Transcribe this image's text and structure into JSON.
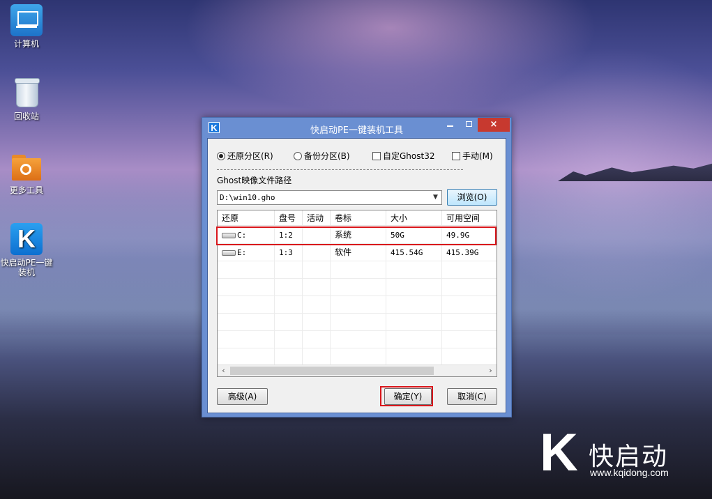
{
  "desktop": {
    "icons": [
      {
        "label": "计算机",
        "icon": "computer-icon"
      },
      {
        "label": "回收站",
        "icon": "recycle-bin-icon"
      },
      {
        "label": "更多工具",
        "icon": "tools-folder-icon"
      },
      {
        "label": "快启动PE一键装机",
        "icon": "kqidong-installer-icon"
      }
    ]
  },
  "dialog": {
    "title": "快启动PE一键装机工具",
    "logo_glyph": "K",
    "close_glyph": "×",
    "options": {
      "restore": {
        "label": "还原分区(R)",
        "checked": true
      },
      "backup": {
        "label": "备份分区(B)",
        "checked": false
      },
      "custom_ghost32": {
        "label": "自定Ghost32",
        "checked": false
      },
      "manual": {
        "label": "手动(M)",
        "checked": false
      }
    },
    "path_label": "Ghost映像文件路径",
    "path_value": "D:\\win10.gho",
    "browse_label": "浏览(O)",
    "table": {
      "columns": [
        "还原",
        "盘号",
        "活动",
        "卷标",
        "大小",
        "可用空间"
      ],
      "rows": [
        {
          "drive": "C:",
          "disk": "1:2",
          "active": "",
          "volume": "系统",
          "size": "50G",
          "free": "49.9G",
          "selected": true
        },
        {
          "drive": "E:",
          "disk": "1:3",
          "active": "",
          "volume": "软件",
          "size": "415.54G",
          "free": "415.39G",
          "selected": false
        }
      ]
    },
    "advanced_label": "高级(A)",
    "ok_label": "确定(Y)",
    "cancel_label": "取消(C)",
    "highlight_color": "#d9161b"
  },
  "brand": {
    "logo_glyph": "K",
    "name": "快启动",
    "url": "www.kqidong.com"
  }
}
